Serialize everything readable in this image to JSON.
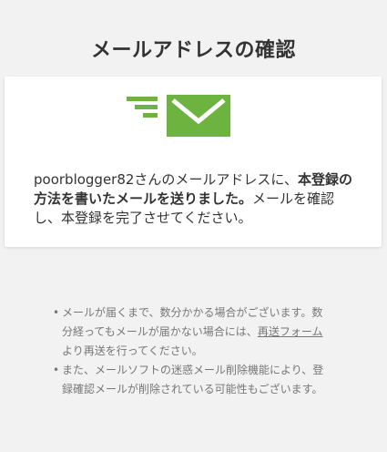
{
  "page": {
    "title": "メールアドレスの確認"
  },
  "card": {
    "icon": "email-sent-icon",
    "icon_color": "#6cb33f",
    "message_part1": "poorblogger82さんのメールアドレスに、",
    "message_bold": "本登録の方法を書いたメールを送りました。",
    "message_part2": "メールを確認し、本登録を完了させてください。"
  },
  "notes": {
    "item1_text_before_link": "メールが届くまで、数分かかる場合がございます。数分経ってもメールが届かない場合には、",
    "item1_link": "再送フォーム",
    "item1_text_after_link": "より再送を行ってください。",
    "item2_text": "また、メールソフトの迷惑メール削除機能により、登録確認メールが削除されている可能性もございます。"
  },
  "colors": {
    "background": "#f2f2f2",
    "card": "#ffffff",
    "text": "#333333",
    "muted_text": "#777777",
    "accent_green": "#6cb33f"
  }
}
